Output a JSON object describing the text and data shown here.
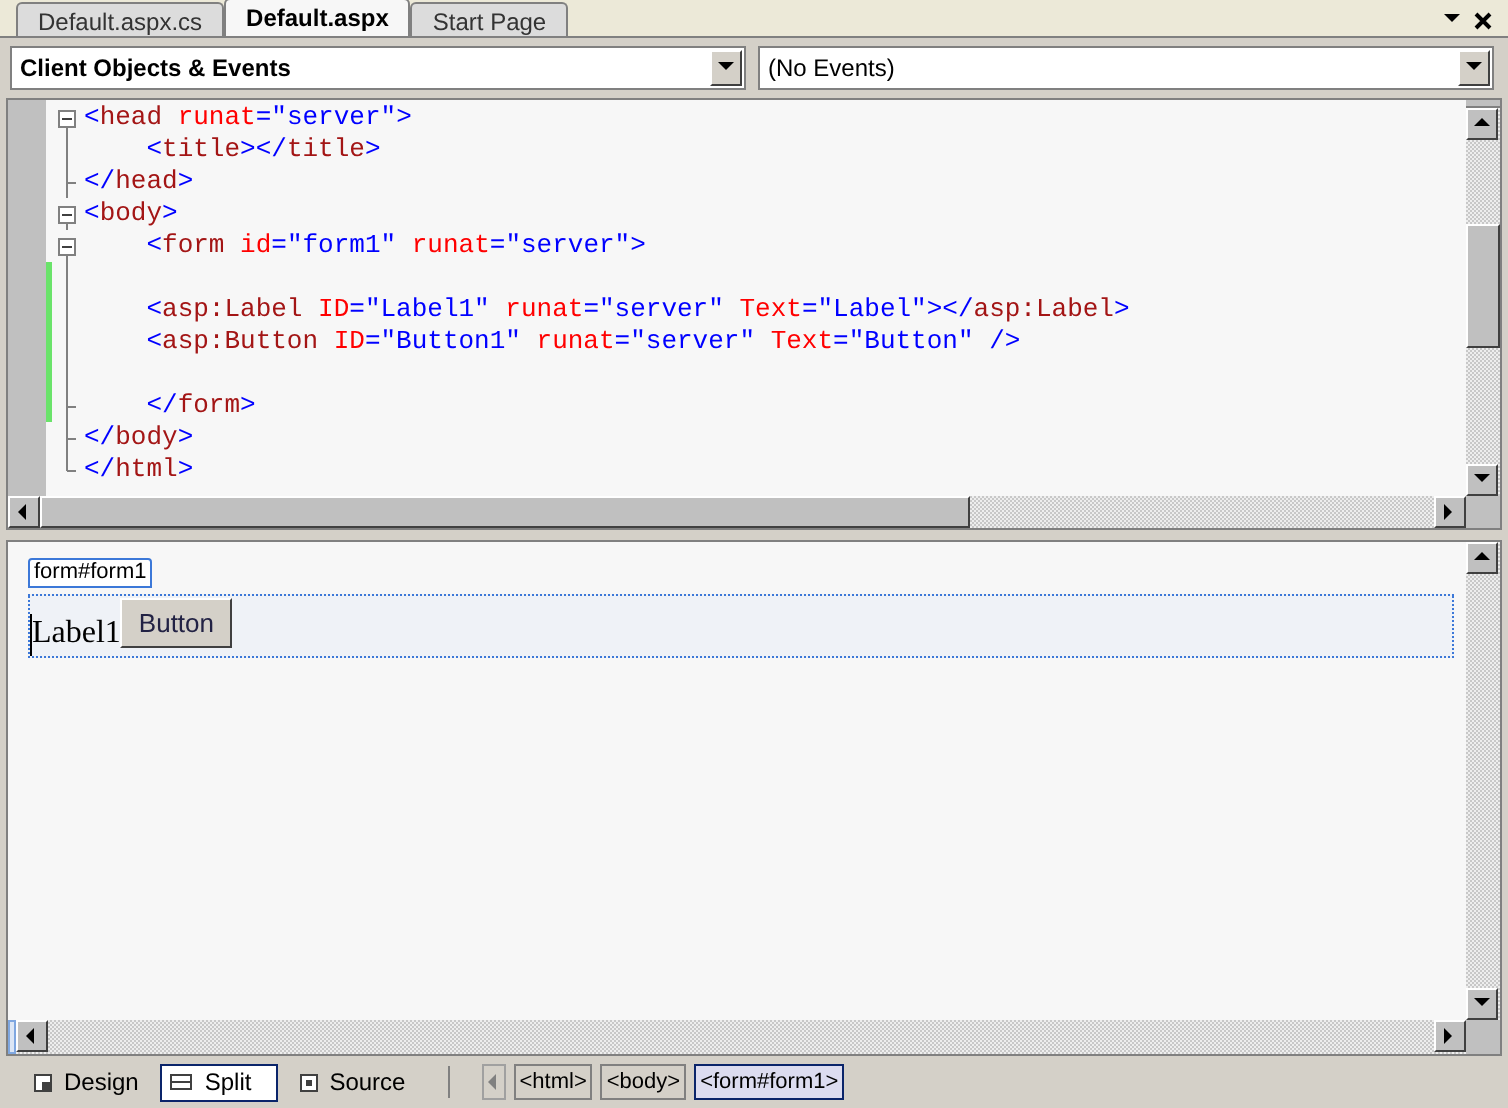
{
  "tabs": [
    {
      "label": "Default.aspx.cs",
      "selected": false
    },
    {
      "label": "Default.aspx",
      "selected": true
    },
    {
      "label": "Start Page",
      "selected": false
    }
  ],
  "dropdowns": [
    {
      "value": "Client Objects & Events",
      "bold": true
    },
    {
      "value": "(No Events)",
      "bold": false
    }
  ],
  "code_lines": [
    {
      "kind": "open",
      "changed": false,
      "tokens": [
        {
          "text": "<",
          "kind": "punct"
        },
        {
          "text": "head",
          "kind": "tag"
        },
        {
          "text": " runat",
          "kind": "attr"
        },
        {
          "text": "=",
          "kind": "punct"
        },
        {
          "text": "\"server\"",
          "kind": "value"
        },
        {
          "text": ">",
          "kind": "punct"
        }
      ]
    },
    {
      "kind": "line",
      "changed": false,
      "tokens": [
        {
          "text": "    <",
          "kind": "punct"
        },
        {
          "text": "title",
          "kind": "tag"
        },
        {
          "text": "></",
          "kind": "punct"
        },
        {
          "text": "title",
          "kind": "tag"
        },
        {
          "text": ">",
          "kind": "punct"
        }
      ]
    },
    {
      "kind": "end",
      "changed": false,
      "tokens": [
        {
          "text": "</",
          "kind": "punct"
        },
        {
          "text": "head",
          "kind": "tag"
        },
        {
          "text": ">",
          "kind": "punct"
        }
      ]
    },
    {
      "kind": "open",
      "changed": false,
      "tokens": [
        {
          "text": "<",
          "kind": "punct"
        },
        {
          "text": "body",
          "kind": "tag"
        },
        {
          "text": ">",
          "kind": "punct"
        }
      ]
    },
    {
      "kind": "open",
      "changed": false,
      "tokens": [
        {
          "text": "    <",
          "kind": "punct"
        },
        {
          "text": "form",
          "kind": "tag"
        },
        {
          "text": " id",
          "kind": "attr"
        },
        {
          "text": "=",
          "kind": "punct"
        },
        {
          "text": "\"form1\"",
          "kind": "value"
        },
        {
          "text": " runat",
          "kind": "attr"
        },
        {
          "text": "=",
          "kind": "punct"
        },
        {
          "text": "\"server\"",
          "kind": "value"
        },
        {
          "text": ">",
          "kind": "punct"
        }
      ]
    },
    {
      "kind": "line",
      "changed": true
    },
    {
      "kind": "line",
      "changed": true,
      "tokens": [
        {
          "text": "    <",
          "kind": "punct"
        },
        {
          "text": "asp:Label",
          "kind": "tag"
        },
        {
          "text": " ID",
          "kind": "attr"
        },
        {
          "text": "=",
          "kind": "punct"
        },
        {
          "text": "\"Label1\"",
          "kind": "value"
        },
        {
          "text": " runat",
          "kind": "attr"
        },
        {
          "text": "=",
          "kind": "punct"
        },
        {
          "text": "\"server\"",
          "kind": "value"
        },
        {
          "text": " Text",
          "kind": "attr"
        },
        {
          "text": "=",
          "kind": "punct"
        },
        {
          "text": "\"Label\"",
          "kind": "value"
        },
        {
          "text": "></",
          "kind": "punct"
        },
        {
          "text": "asp:Label",
          "kind": "tag"
        },
        {
          "text": ">",
          "kind": "punct"
        }
      ]
    },
    {
      "kind": "line",
      "changed": true,
      "tokens": [
        {
          "text": "    <",
          "kind": "punct"
        },
        {
          "text": "asp:Button",
          "kind": "tag"
        },
        {
          "text": " ID",
          "kind": "attr"
        },
        {
          "text": "=",
          "kind": "punct"
        },
        {
          "text": "\"Button1\"",
          "kind": "value"
        },
        {
          "text": " runat",
          "kind": "attr"
        },
        {
          "text": "=",
          "kind": "punct"
        },
        {
          "text": "\"server\"",
          "kind": "value"
        },
        {
          "text": " Text",
          "kind": "attr"
        },
        {
          "text": "=",
          "kind": "punct"
        },
        {
          "text": "\"Button\"",
          "kind": "value"
        },
        {
          "text": " />",
          "kind": "punct"
        }
      ]
    },
    {
      "kind": "line",
      "changed": true
    },
    {
      "kind": "end",
      "changed": true,
      "tokens": [
        {
          "text": "    </",
          "kind": "punct"
        },
        {
          "text": "form",
          "kind": "tag"
        },
        {
          "text": ">",
          "kind": "punct"
        }
      ]
    },
    {
      "kind": "end",
      "changed": false,
      "tokens": [
        {
          "text": "</",
          "kind": "punct"
        },
        {
          "text": "body",
          "kind": "tag"
        },
        {
          "text": ">",
          "kind": "punct"
        }
      ]
    },
    {
      "kind": "last",
      "changed": false,
      "tokens": [
        {
          "text": "</",
          "kind": "punct"
        },
        {
          "text": "html",
          "kind": "tag"
        },
        {
          "text": ">",
          "kind": "punct"
        }
      ]
    }
  ],
  "design": {
    "form_tag": "form#form1",
    "label": "Label1",
    "button": "Button"
  },
  "views": [
    {
      "label": "Design",
      "selected": false
    },
    {
      "label": "Split",
      "selected": true
    },
    {
      "label": "Source",
      "selected": false
    }
  ],
  "breadcrumbs": [
    {
      "label": "<html>",
      "selected": false
    },
    {
      "label": "<body>",
      "selected": false
    },
    {
      "label": "<form#form1>",
      "selected": true
    }
  ]
}
